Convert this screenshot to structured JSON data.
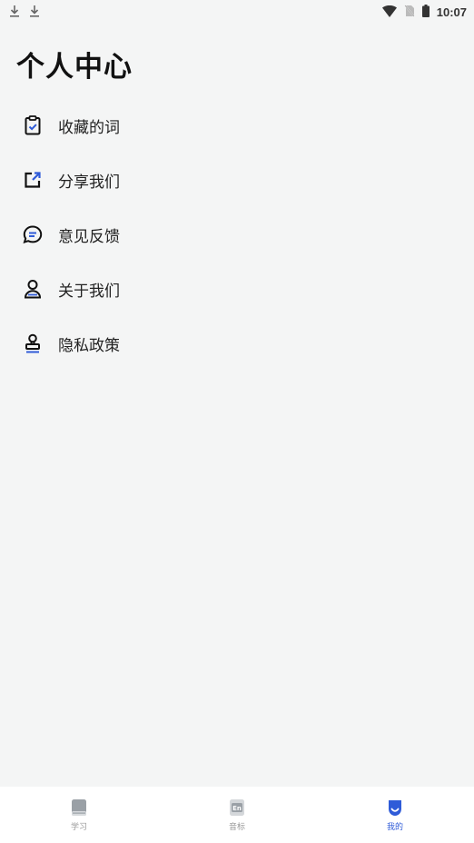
{
  "status_bar": {
    "time": "10:07",
    "left_icons": [
      "download-icon",
      "download-icon"
    ],
    "right_icons": [
      "wifi-icon",
      "no-sim-icon",
      "battery-icon"
    ]
  },
  "page": {
    "title": "个人中心"
  },
  "menu": {
    "items": [
      {
        "label": "收藏的词",
        "icon": "clipboard-check-icon"
      },
      {
        "label": "分享我们",
        "icon": "share-external-icon"
      },
      {
        "label": "意见反馈",
        "icon": "chat-bubble-icon"
      },
      {
        "label": "关于我们",
        "icon": "person-icon"
      },
      {
        "label": "隐私政策",
        "icon": "stamp-icon"
      }
    ]
  },
  "tabbar": {
    "tabs": [
      {
        "label": "学习",
        "icon": "book-icon",
        "active": false
      },
      {
        "label": "音标",
        "icon": "en-card-icon",
        "active": false
      },
      {
        "label": "我的",
        "icon": "profile-shield-icon",
        "active": true
      }
    ]
  },
  "colors": {
    "accent": "#2f5bd8",
    "background": "#f4f5f5",
    "inactive": "#9a9a9a"
  }
}
